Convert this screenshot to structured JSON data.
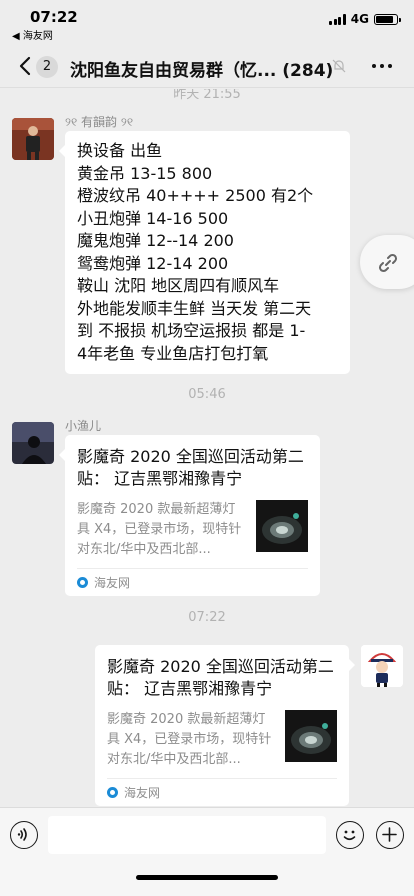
{
  "status_bar": {
    "time": "07:22",
    "back_app": "◀ 海友网",
    "network": "4G",
    "battery_level": 0.85
  },
  "nav": {
    "unread_count": "2",
    "title": "沈阳鱼友自由贸易群（忆... (284)"
  },
  "messages": [
    {
      "type": "timestamp",
      "text": "昨天 21:55"
    },
    {
      "type": "text",
      "side": "left",
      "sender": "୨୧ 有韻韵 ୨୧",
      "lines": [
        "换设备   出鱼",
        "黄金吊  13-15    800",
        "橙波纹吊  40++++   2500  有2个",
        "小丑炮弹   14-16   500",
        "魔鬼炮弹  12--14  200",
        "鸳鸯炮弹 12-14   200",
        "鞍山  沈阳  地区周四有顺风车",
        "外地能发顺丰生鲜  当天发  第二天",
        "到  不报损  机场空运报损  都是 1-",
        "4年老鱼  专业鱼店打包打氧"
      ]
    },
    {
      "type": "timestamp",
      "text": "05:46"
    },
    {
      "type": "link",
      "side": "left",
      "sender": "小渔儿",
      "title": "影魔奇 2020 全国巡回活动第二贴：  辽吉黑鄂湘豫青宁",
      "desc": "影魔奇 2020 款最新超薄灯具 X4，已登录市场，现特针对东北/华中及西北部...",
      "source": "海友网"
    },
    {
      "type": "timestamp",
      "text": "07:22"
    },
    {
      "type": "link",
      "side": "right",
      "title": "影魔奇 2020 全国巡回活动第二贴：  辽吉黑鄂湘豫青宁",
      "desc": "影魔奇 2020 款最新超薄灯具 X4，已登录市场，现特针对东北/华中及西北部...",
      "source": "海友网"
    }
  ],
  "input": {
    "placeholder": ""
  },
  "icons": {
    "back": "chevron-left-icon",
    "mute": "bell-muted-icon",
    "more": "more-dots-icon",
    "link": "link-icon",
    "voice": "voice-icon",
    "emoji": "emoji-icon",
    "plus": "plus-icon"
  }
}
